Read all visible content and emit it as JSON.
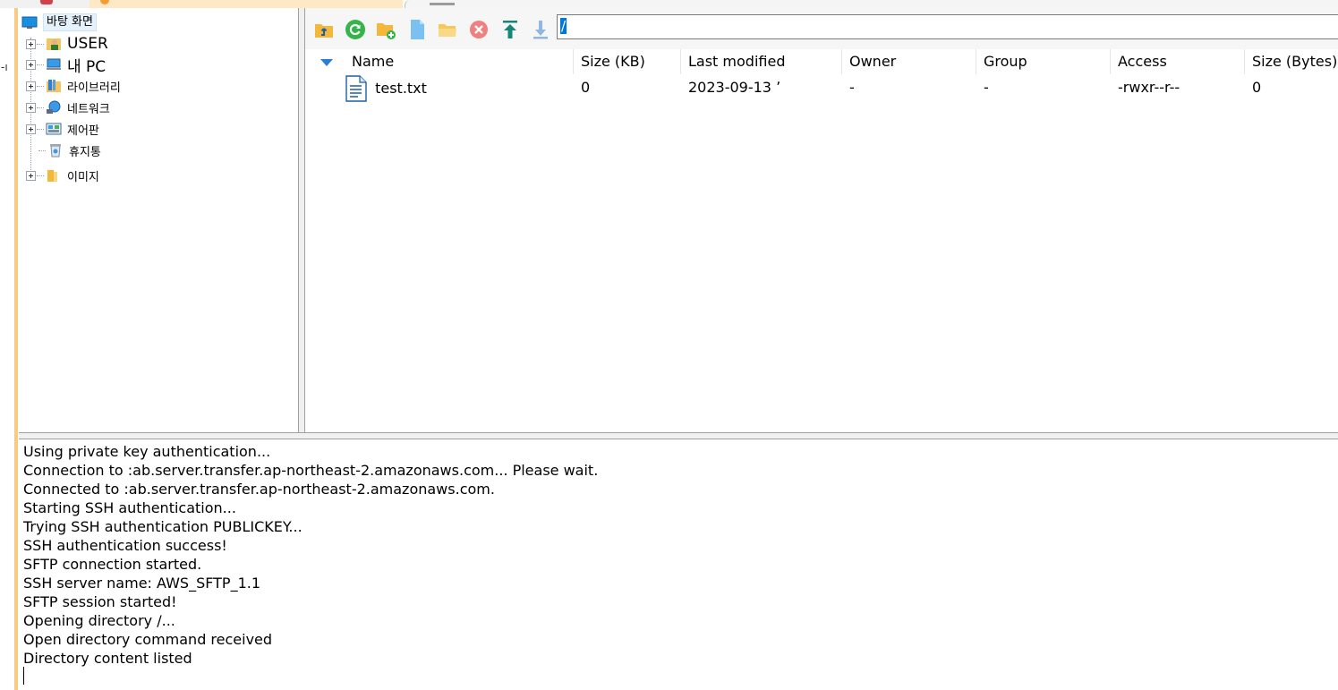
{
  "tree": {
    "desktop_label": "바탕 화면",
    "items": [
      {
        "label": "USER",
        "icon": "user-folder-icon"
      },
      {
        "label": "내 PC",
        "icon": "computer-icon"
      },
      {
        "label": "라이브러리",
        "icon": "library-icon"
      },
      {
        "label": "네트워크",
        "icon": "network-icon"
      },
      {
        "label": "제어판",
        "icon": "control-panel-icon"
      },
      {
        "label": "휴지통",
        "icon": "recycle-bin-icon"
      },
      {
        "label": "이미지",
        "icon": "folder-icon"
      }
    ]
  },
  "toolbar": {
    "buttons": [
      "parent-folder-icon",
      "refresh-icon",
      "new-folder-icon",
      "new-file-icon",
      "open-folder-icon",
      "delete-icon",
      "upload-icon",
      "download-icon"
    ],
    "path_value": "/"
  },
  "filelist": {
    "columns": [
      "Name",
      "Size (KB)",
      "Last modified",
      "Owner",
      "Group",
      "Access",
      "Size (Bytes)"
    ],
    "rows": [
      {
        "name": "test.txt",
        "size_kb": "0",
        "modified": "2023-09-13 ʼ",
        "owner": "-",
        "group": "-",
        "access": "-rwxr--r--",
        "size_bytes": "0"
      }
    ]
  },
  "log": {
    "lines": [
      "Using private key authentication...",
      "Connection to :ab.server.transfer.ap-northeast-2.amazonaws.com... Please wait.",
      "Connected to :ab.server.transfer.ap-northeast-2.amazonaws.com.",
      "Starting SSH authentication...",
      "Trying SSH authentication PUBLICKEY...",
      "SSH authentication success!",
      "SFTP connection started.",
      "SSH server name: AWS_SFTP_1.1",
      "SFTP session started!",
      "Opening directory /...",
      "Open directory command received",
      "Directory content listed"
    ]
  },
  "colors": {
    "accent": "#0078d7",
    "tab_orange": "#f9ca82"
  }
}
